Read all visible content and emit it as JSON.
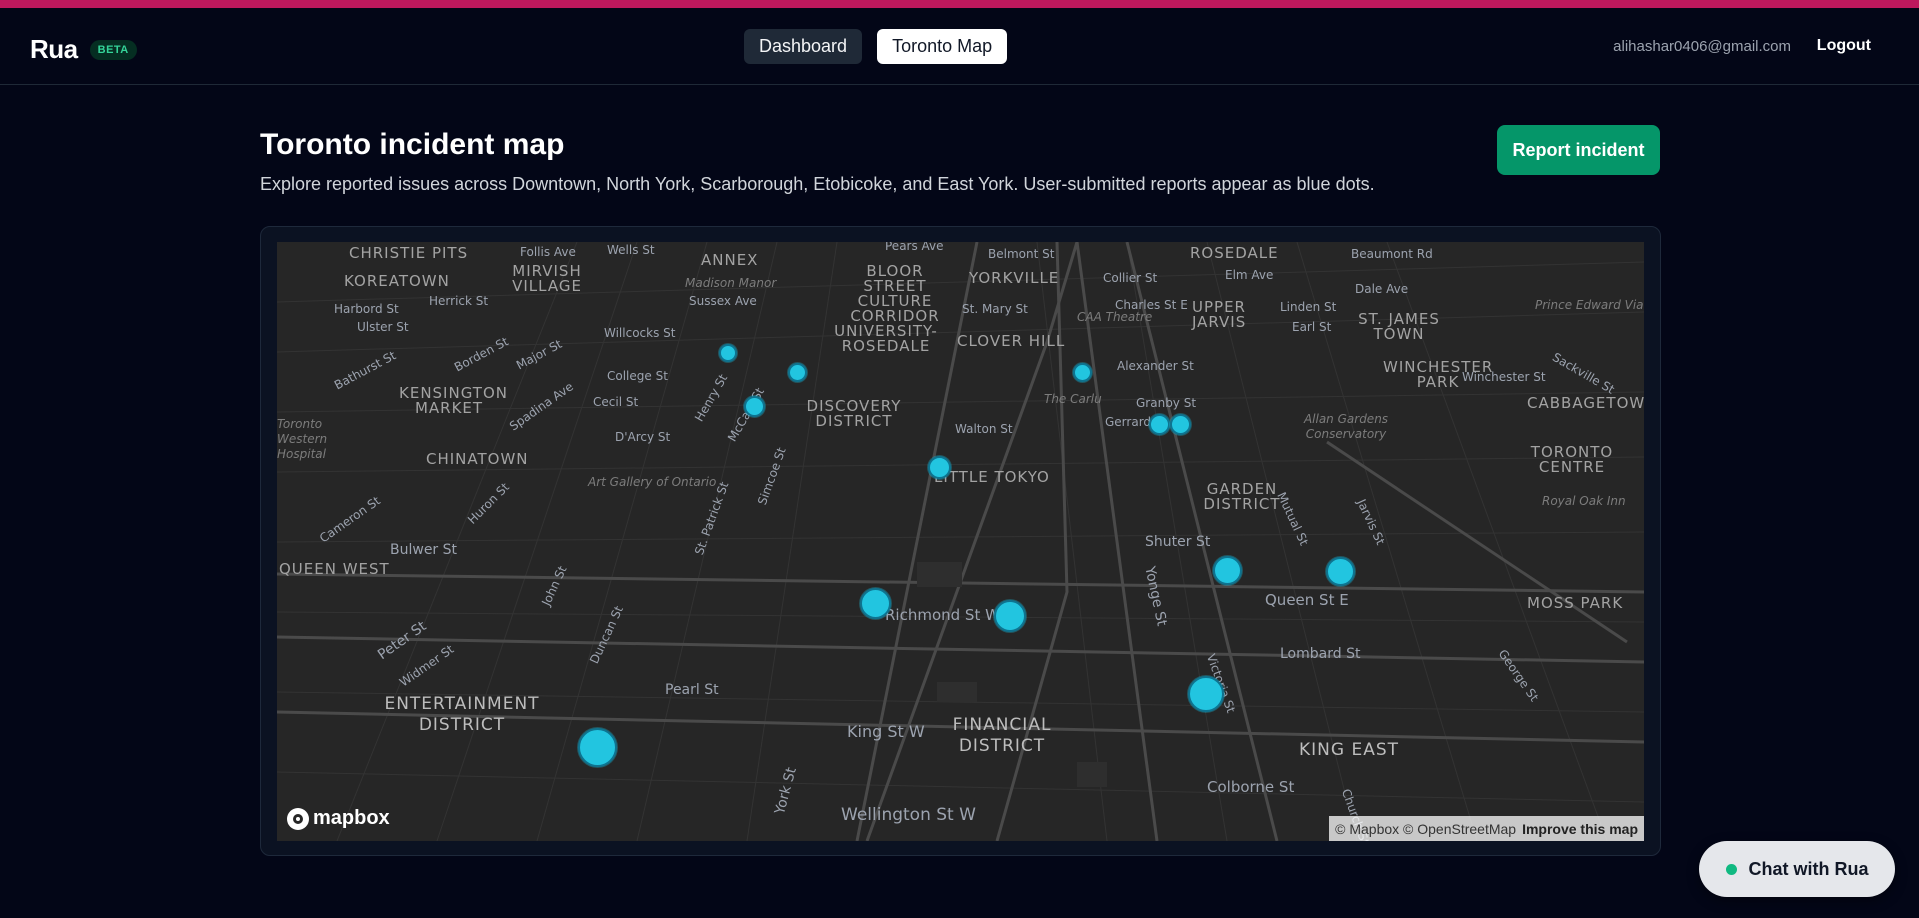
{
  "header": {
    "brand": "Rua",
    "badge": "BETA",
    "tabs": [
      {
        "label": "Dashboard",
        "active": false
      },
      {
        "label": "Toronto Map",
        "active": true
      }
    ],
    "user_email": "alihashar0406@gmail.com",
    "logout_label": "Logout"
  },
  "page": {
    "title": "Toronto incident map",
    "subtitle": "Explore reported issues across Downtown, North York, Scarborough, Etobicoke, and East York. User-submitted reports appear as blue dots.",
    "report_button": "Report incident"
  },
  "map": {
    "district_labels": [
      "CHRISTIE PITS",
      "KOREATOWN",
      "MIRVISH VILLAGE",
      "ANNEX",
      "BLOOR STREET CULTURE CORRIDOR",
      "YORKVILLE",
      "ROSEDALE",
      "UPPER JARVIS",
      "ST. JAMES TOWN",
      "KENSINGTON MARKET",
      "UNIVERSITY-ROSEDALE",
      "CLOVER HILL",
      "WINCHESTER PARK",
      "CABBAGETOWN",
      "DISCOVERY DISTRICT",
      "CHINATOWN",
      "LITTLE TOKYO",
      "TORONTO CENTRE",
      "GARDEN DISTRICT",
      "QUEEN WEST",
      "MOSS PARK",
      "ENTERTAINMENT DISTRICT",
      "FINANCIAL DISTRICT",
      "KING EAST"
    ],
    "street_labels": [
      "Follis Ave",
      "Wells St",
      "Pears Ave",
      "Belmont St",
      "Beaumont Rd",
      "Harbord St",
      "Herrick St",
      "Madison Manor",
      "Sussex Ave",
      "Collier St",
      "Elm Ave",
      "Dale Ave",
      "Ulster St",
      "Willcocks St",
      "St. Mary St",
      "Charles St E",
      "Linden St",
      "Earl St",
      "Bathurst St",
      "Borden St",
      "Major St",
      "College St",
      "Alexander St",
      "Winchester St",
      "Sackville St",
      "Cecil St",
      "Henry St",
      "McCaul St",
      "Granby St",
      "Gerrard",
      "Spadina Ave",
      "D'Arcy St",
      "Walton St",
      "Simcoe St",
      "St. Patrick St",
      "Cameron St",
      "Huron St",
      "Mutual St",
      "Jarvis St",
      "Bulwer St",
      "Shuter St",
      "John St",
      "Queen St E",
      "Peter St",
      "Duncan St",
      "Richmond St W",
      "Yonge St",
      "Widmer St",
      "Lombard St",
      "Victoria St",
      "George St",
      "Pearl St",
      "King St W",
      "York St",
      "Colborne St",
      "Church St",
      "Wellington St W"
    ],
    "poi_labels": [
      "CAA Theatre",
      "The Carlu",
      "Allan Gardens Conservatory",
      "Art Gallery of Ontario",
      "Toronto Western Hospital",
      "Royal Oak Inn",
      "Prince Edward Viaduct"
    ],
    "logo_text": "mapbox",
    "attribution": "© Mapbox © OpenStreetMap",
    "improve_link": "Improve this map",
    "marker_count": 14
  },
  "chat": {
    "label": "Chat with Rua"
  }
}
